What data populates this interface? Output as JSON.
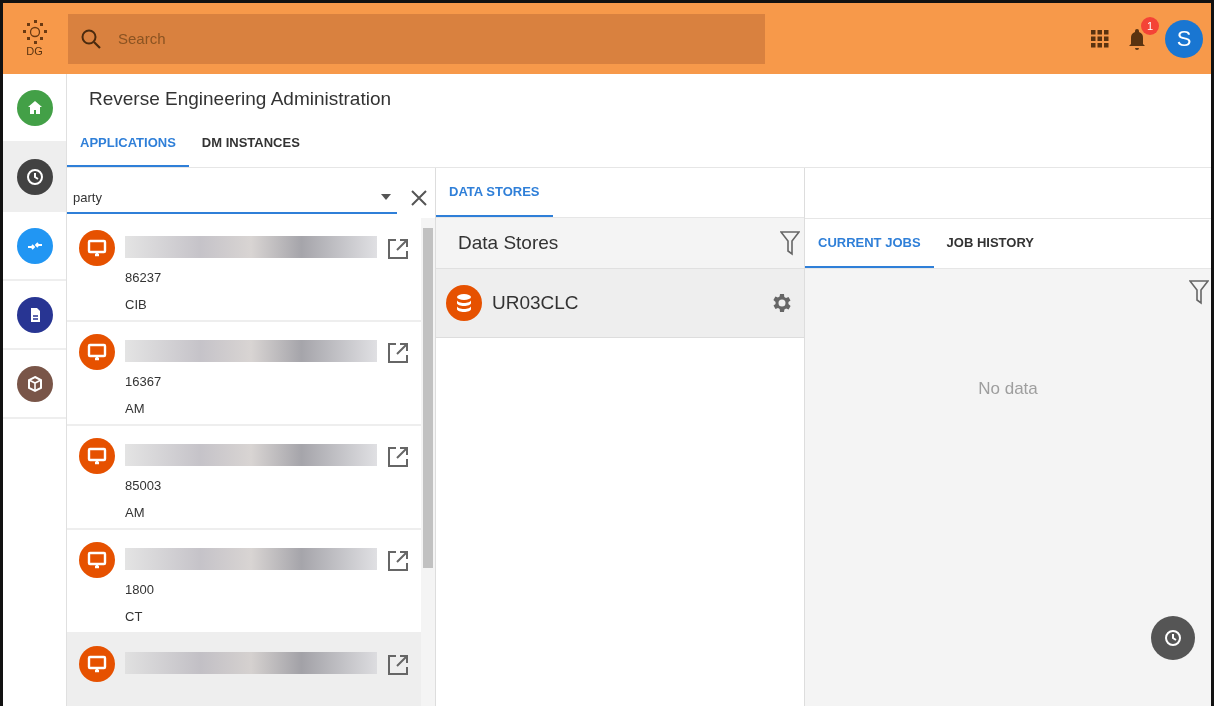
{
  "header": {
    "logo_text": "DG",
    "search": {
      "placeholder": "Search"
    },
    "notification_count": "1",
    "avatar_letter": "S"
  },
  "sidebar": {
    "items": [
      {
        "kind": "home",
        "selected": false,
        "color": "#43a047"
      },
      {
        "kind": "clock",
        "selected": true,
        "color": "#424242"
      },
      {
        "kind": "swap",
        "selected": false,
        "color": "#2196f3"
      },
      {
        "kind": "document",
        "selected": false,
        "color": "#283593"
      },
      {
        "kind": "cube",
        "selected": false,
        "color": "#795548"
      }
    ]
  },
  "page": {
    "title": "Reverse Engineering Administration",
    "tabs": [
      {
        "label": "APPLICATIONS",
        "selected": true
      },
      {
        "label": "DM INSTANCES",
        "selected": false
      }
    ]
  },
  "applications": {
    "filter": {
      "value": "party"
    },
    "items": [
      {
        "code": "86237",
        "unit": "CIB",
        "selected": false
      },
      {
        "code": "16367",
        "unit": "AM",
        "selected": false
      },
      {
        "code": "85003",
        "unit": "AM",
        "selected": false
      },
      {
        "code": "1800",
        "unit": "CT",
        "selected": false
      },
      {
        "selected": true
      }
    ]
  },
  "detail": {
    "tabs": [
      {
        "label": "DATA STORES",
        "selected": true
      }
    ],
    "data_stores": {
      "title": "Data Stores",
      "items": [
        {
          "name": "UR03CLC",
          "selected": true
        }
      ]
    },
    "jobs": {
      "tabs": [
        {
          "label": "CURRENT JOBS",
          "selected": true
        },
        {
          "label": "JOB HISTORY",
          "selected": false
        }
      ],
      "empty_text": "No data"
    }
  }
}
